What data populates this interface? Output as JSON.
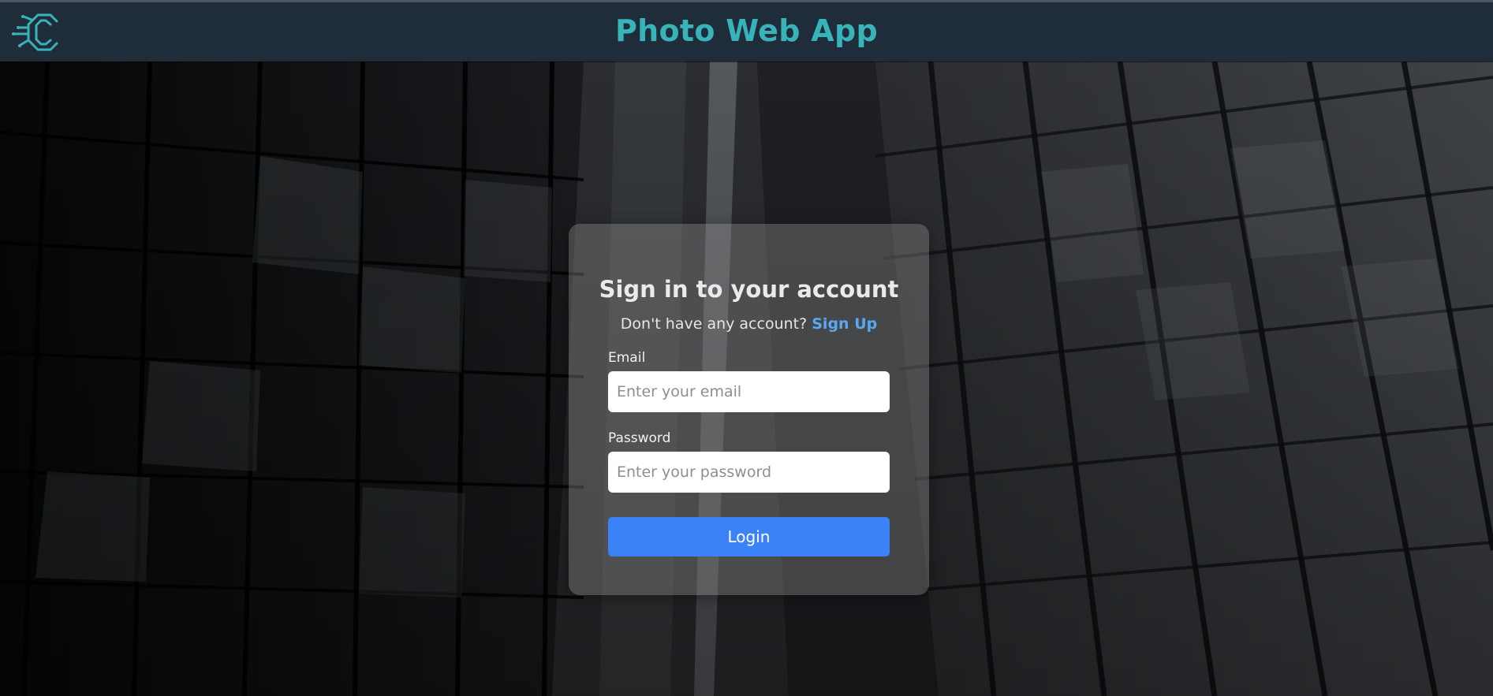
{
  "header": {
    "title": "Photo Web App",
    "logo_icon": "c-circuit-logo-icon",
    "accent_color": "#39b3ba",
    "background_color": "#1f2d3b"
  },
  "background": {
    "image": "dark-skyscraper-photo"
  },
  "login_card": {
    "title": "Sign in to your account",
    "signup_prompt": "Don't have any account?",
    "signup_link": "Sign Up",
    "email_label": "Email",
    "email_placeholder": "Enter your email",
    "email_value": "",
    "password_label": "Password",
    "password_placeholder": "Enter your password",
    "password_value": "",
    "login_button": "Login",
    "button_color": "#3b82f6",
    "link_color": "#5aa8f2"
  }
}
